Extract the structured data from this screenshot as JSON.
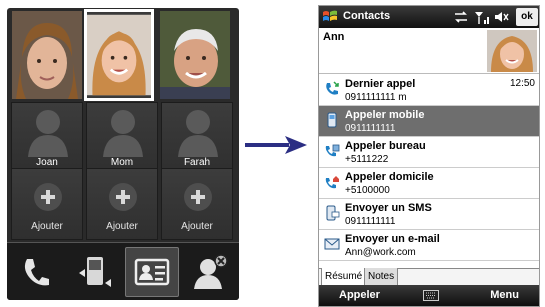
{
  "left_screen": {
    "favorite_names": [
      "Joan",
      "Mom",
      "Farah"
    ],
    "add_label": "Ajouter",
    "add_slots": 3,
    "toolbar": [
      "phone-icon",
      "call-history-icon",
      "contact-card-icon",
      "remove-contact-icon"
    ]
  },
  "right_screen": {
    "status": {
      "title": "Contacts",
      "ok": "ok"
    },
    "contact_name": "Ann",
    "actions": [
      {
        "title": "Dernier appel",
        "sub": "0911111111 m",
        "time": "12:50",
        "icon": "call-log-icon"
      },
      {
        "title": "Appeler mobile",
        "sub": "0911111111",
        "icon": "mobile-phone-icon",
        "selected": true
      },
      {
        "title": "Appeler bureau",
        "sub": "+5111222",
        "icon": "work-phone-icon"
      },
      {
        "title": "Appeler domicile",
        "sub": "+5100000",
        "icon": "home-phone-icon"
      },
      {
        "title": "Envoyer un SMS",
        "sub": "0911111111",
        "icon": "sms-icon"
      },
      {
        "title": "Envoyer un e-mail",
        "sub": "Ann@work.com",
        "icon": "email-icon"
      }
    ],
    "tabs": [
      "Résumé",
      "Notes"
    ],
    "softkeys": {
      "left": "Appeler",
      "right": "Menu"
    }
  },
  "colors": {
    "selection": "#6e6e6e",
    "arrow": "#2b2e83"
  }
}
